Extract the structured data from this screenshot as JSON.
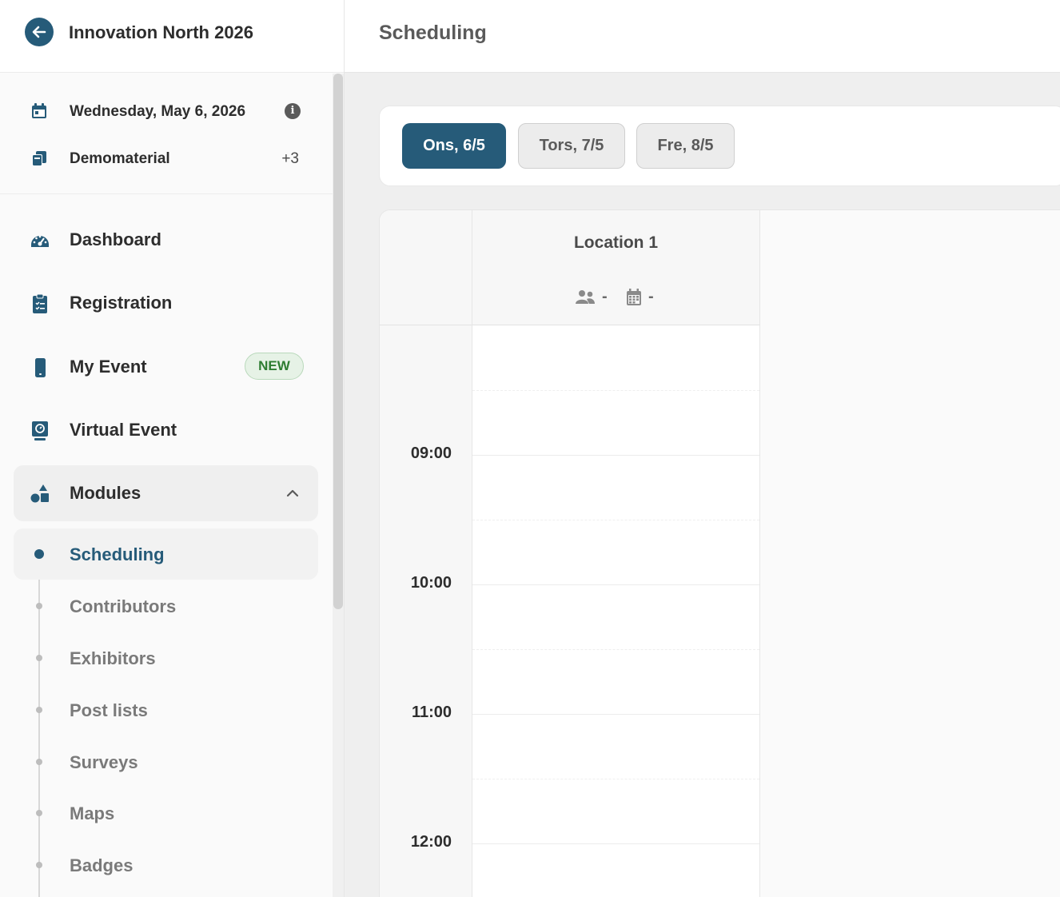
{
  "sidebar": {
    "event_name": "Innovation North 2026",
    "date": "Wednesday, May 6, 2026",
    "info_glyph": "i",
    "material": "Demomaterial",
    "material_extra": "+3",
    "nav": {
      "dashboard": "Dashboard",
      "registration": "Registration",
      "my_event": "My Event",
      "new_badge": "NEW",
      "virtual_event": "Virtual Event",
      "modules": "Modules"
    },
    "submodules": [
      "Scheduling",
      "Contributors",
      "Exhibitors",
      "Post lists",
      "Surveys",
      "Maps",
      "Badges"
    ],
    "active_submodule": "Scheduling"
  },
  "header": {
    "title": "Scheduling"
  },
  "days": [
    "Ons, 6/5",
    "Tors, 7/5",
    "Fre, 8/5"
  ],
  "active_day": "Ons, 6/5",
  "schedule": {
    "location_name": "Location 1",
    "participants_value": "-",
    "events_value": "-",
    "times": [
      "09:00",
      "10:00",
      "11:00",
      "12:00"
    ]
  },
  "colors": {
    "accent": "#265b79",
    "badge_green": "#2e7d32"
  },
  "icons": [
    "arrow-left-icon",
    "calendar-icon",
    "copy-icon",
    "info-icon",
    "dashboard-icon",
    "clipboard-icon",
    "mobile-icon",
    "monitor-icon",
    "shapes-icon",
    "chevron-up-icon",
    "users-icon",
    "calendar-grid-icon"
  ]
}
